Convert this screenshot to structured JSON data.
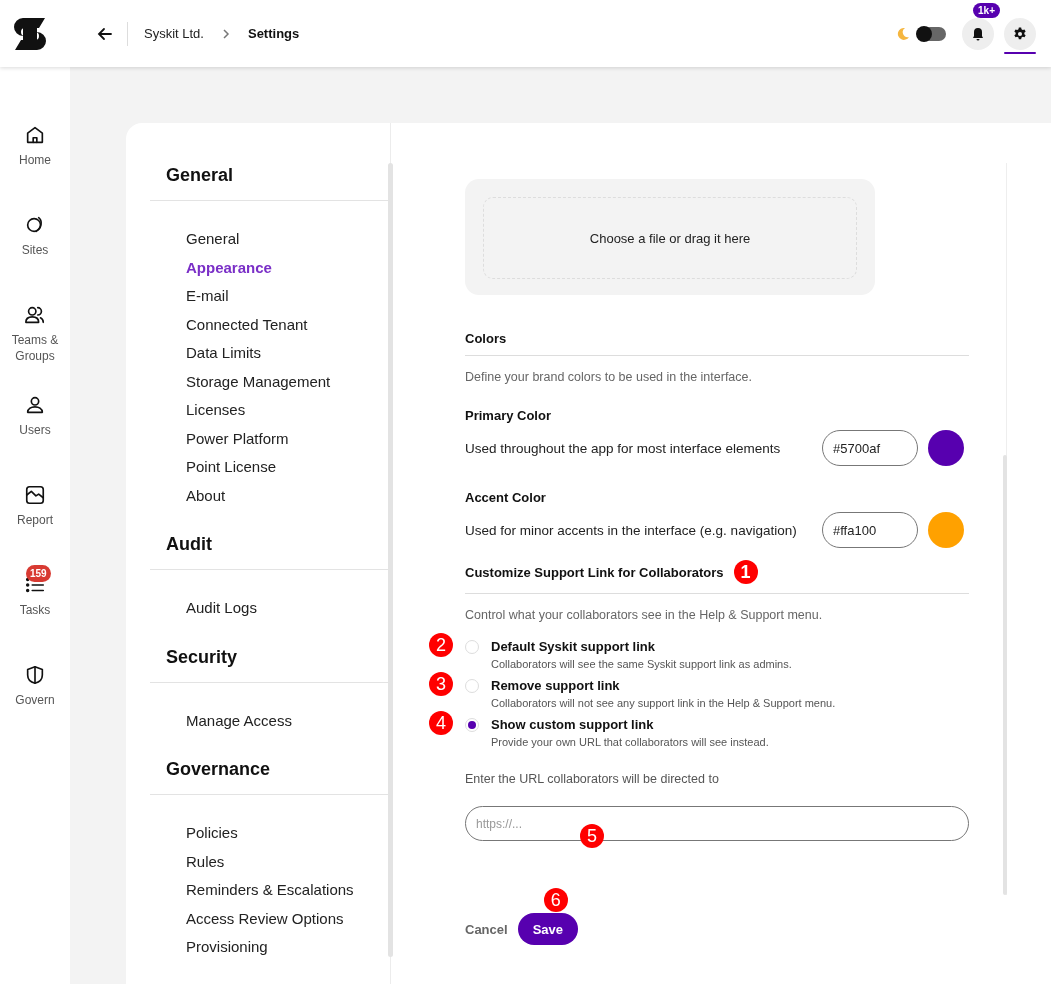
{
  "topbar": {
    "breadcrumb": [
      {
        "label": "Syskit Ltd.",
        "current": false
      },
      {
        "label": "Settings",
        "current": true
      }
    ],
    "dark_mode": {
      "on": false
    },
    "notifications": {
      "badge": "1k+"
    },
    "settings_button": {
      "selected": true
    }
  },
  "nav": [
    {
      "label": "Home"
    },
    {
      "label": "Sites"
    },
    {
      "label": "Teams & Groups"
    },
    {
      "label": "Users"
    },
    {
      "label": "Report"
    },
    {
      "label": "Tasks",
      "badge": "159"
    },
    {
      "label": "Govern"
    }
  ],
  "settings_nav": [
    {
      "title": "General",
      "items": [
        {
          "label": "General",
          "selected": false
        },
        {
          "label": "Appearance",
          "selected": true
        },
        {
          "label": "E-mail",
          "selected": false
        },
        {
          "label": "Connected Tenant",
          "selected": false
        },
        {
          "label": "Data Limits",
          "selected": false
        },
        {
          "label": "Storage Management",
          "selected": false
        },
        {
          "label": "Licenses",
          "selected": false
        },
        {
          "label": "Power Platform",
          "selected": false
        },
        {
          "label": "Point License",
          "selected": false
        },
        {
          "label": "About",
          "selected": false
        }
      ]
    },
    {
      "title": "Audit",
      "items": [
        {
          "label": "Audit Logs",
          "selected": false
        }
      ]
    },
    {
      "title": "Security",
      "items": [
        {
          "label": "Manage Access",
          "selected": false
        }
      ]
    },
    {
      "title": "Governance",
      "items": [
        {
          "label": "Policies",
          "selected": false
        },
        {
          "label": "Rules",
          "selected": false
        },
        {
          "label": "Reminders & Escalations",
          "selected": false
        },
        {
          "label": "Access Review Options",
          "selected": false
        },
        {
          "label": "Provisioning",
          "selected": false
        }
      ]
    }
  ],
  "upload": {
    "label": "Choose a file or drag it here"
  },
  "colors": {
    "title": "Colors",
    "description": "Define your brand colors to be used in the interface.",
    "fields": [
      {
        "label": "Primary Color",
        "description": "Used throughout the app for most interface elements",
        "value": "#5700af",
        "color": "#5700af"
      },
      {
        "label": "Accent Color",
        "description": "Used for minor accents in the interface (e.g. navigation)",
        "value": "#ffa100",
        "color": "#ffa100"
      }
    ]
  },
  "support_link": {
    "title": "Customize Support Link for Collaborators",
    "callout": "1",
    "description": "Control what your collaborators see in the Help & Support menu.",
    "options": [
      {
        "label": "Default Syskit support link",
        "description": "Collaborators will see the same Syskit support link as admins.",
        "selected": false,
        "callout": "2"
      },
      {
        "label": "Remove support link",
        "description": "Collaborators will not see any support link in the Help & Support menu.",
        "selected": false,
        "callout": "3"
      },
      {
        "label": "Show custom support link",
        "description": "Provide your own URL that collaborators will see instead.",
        "selected": true,
        "callout": "4"
      }
    ],
    "url_label": "Enter the URL collaborators will be directed to",
    "url_field": {
      "placeholder": "https://...",
      "callout": "5"
    }
  },
  "actions": {
    "cancel": "Cancel",
    "save": "Save",
    "save_callout": "6"
  }
}
